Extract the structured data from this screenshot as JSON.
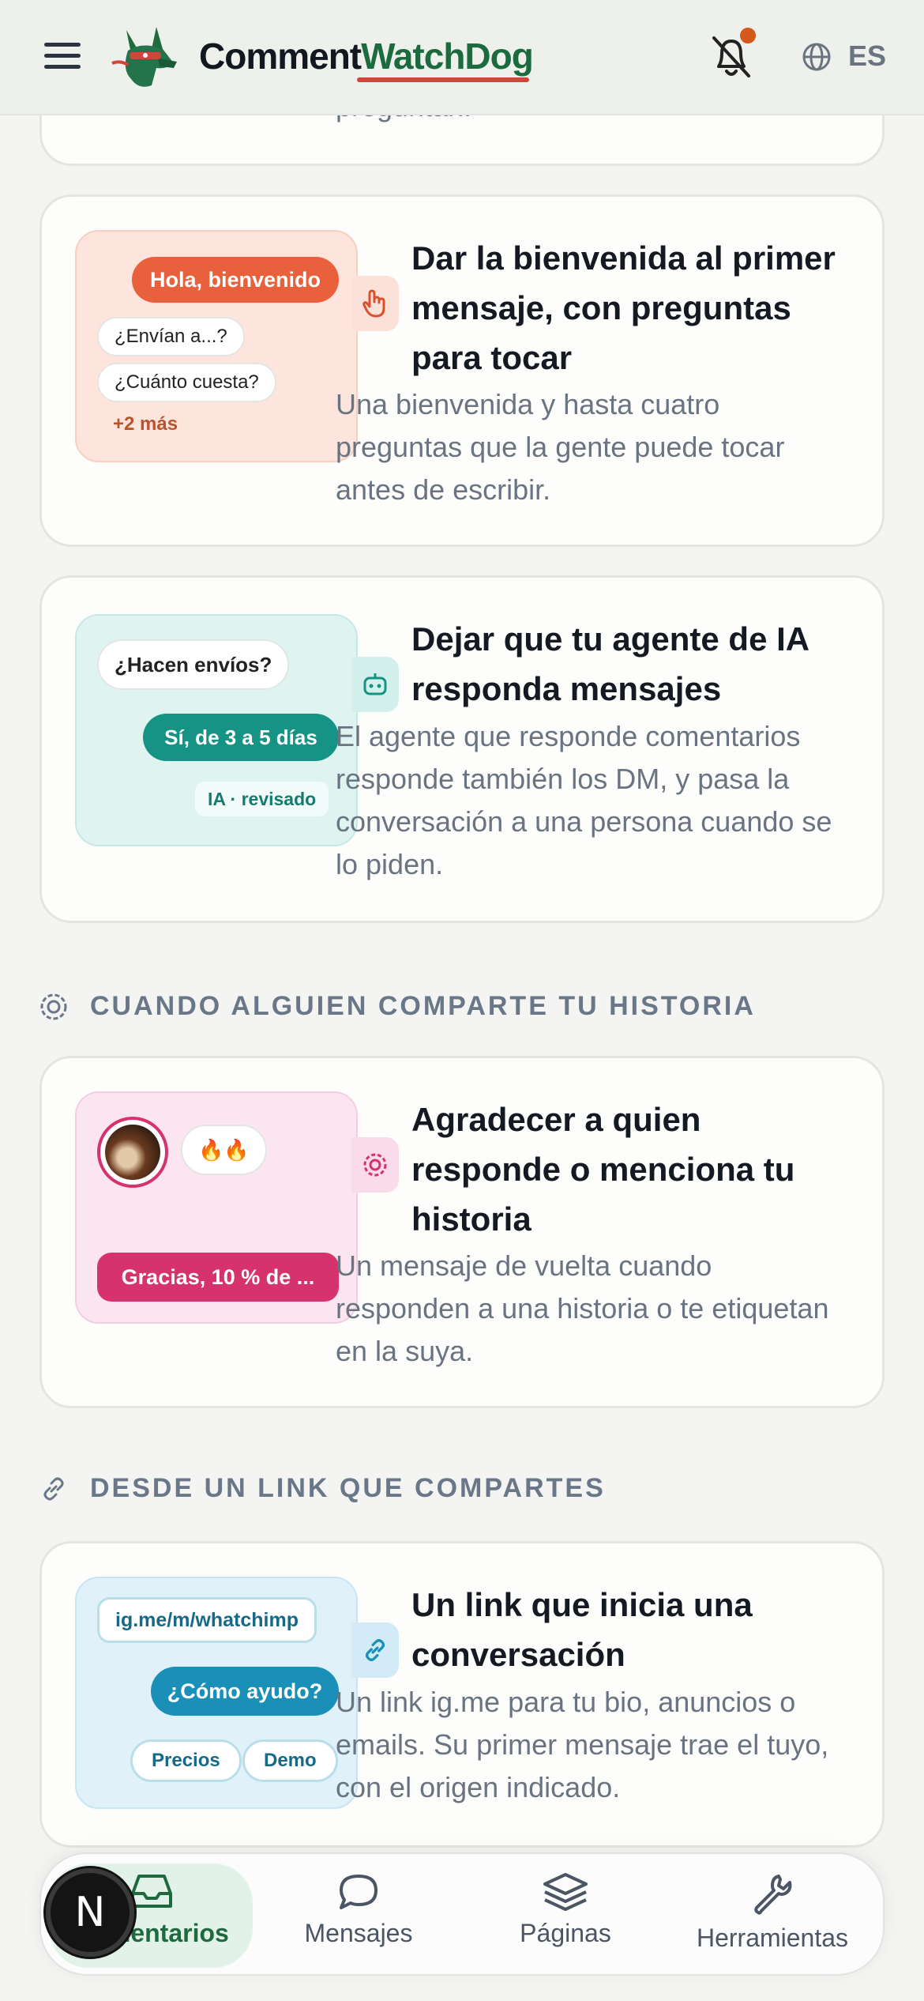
{
  "header": {
    "logo_part1": "Comment",
    "logo_part2": "WatchDog",
    "language": "ES",
    "icons": [
      "menu-icon",
      "bell-off-icon",
      "globe-icon"
    ]
  },
  "top_fragment": "preguntan.",
  "cards": [
    {
      "title": "Dar la bienvenida al primer mensaje, con preguntas para tocar",
      "description": "Una bienvenida y hasta cuatro preguntas que la gente puede tocar antes de escribir.",
      "preview": {
        "welcome": "Hola, bienvenido",
        "q1": "¿Envían a...?",
        "q2": "¿Cuánto cuesta?",
        "more": "+2 más"
      }
    },
    {
      "title": "Dejar que tu agente de IA responda mensajes",
      "description": "El agente que responde comentarios responde también los DM, y pasa la conversación a una persona cuando se lo piden.",
      "preview": {
        "question": "¿Hacen envíos?",
        "answer": "Sí, de 3 a 5 días",
        "tag": "IA · revisado"
      }
    },
    {
      "title": "Agradecer a quien responde o menciona tu historia",
      "description": "Un mensaje de vuelta cuando responden a una historia o te etiquetan en la suya.",
      "preview": {
        "reaction": "🔥🔥",
        "message": "Gracias, 10 % de ..."
      }
    },
    {
      "title": "Un link que inicia una conversación",
      "description": "Un link ig.me para tu bio, anuncios o emails. Su primer mensaje trae el tuyo, con el origen indicado.",
      "preview": {
        "link": "ig.me/m/whatchimp",
        "message": "¿Cómo ayudo?",
        "option1": "Precios",
        "option2": "Demo"
      }
    }
  ],
  "sections": {
    "story": "CUANDO ALGUIEN COMPARTE TU HISTORIA",
    "link": "DESDE UN LINK QUE COMPARTES"
  },
  "bottom_nav": {
    "items": [
      {
        "label": "Comentarios",
        "icon": "inbox-icon",
        "active": true
      },
      {
        "label": "Mensajes",
        "icon": "chat-bubble-icon",
        "active": false
      },
      {
        "label": "Páginas",
        "icon": "layers-icon",
        "active": false
      },
      {
        "label": "Herramientas",
        "icon": "wrench-icon",
        "active": false
      }
    ],
    "badge": "N"
  }
}
